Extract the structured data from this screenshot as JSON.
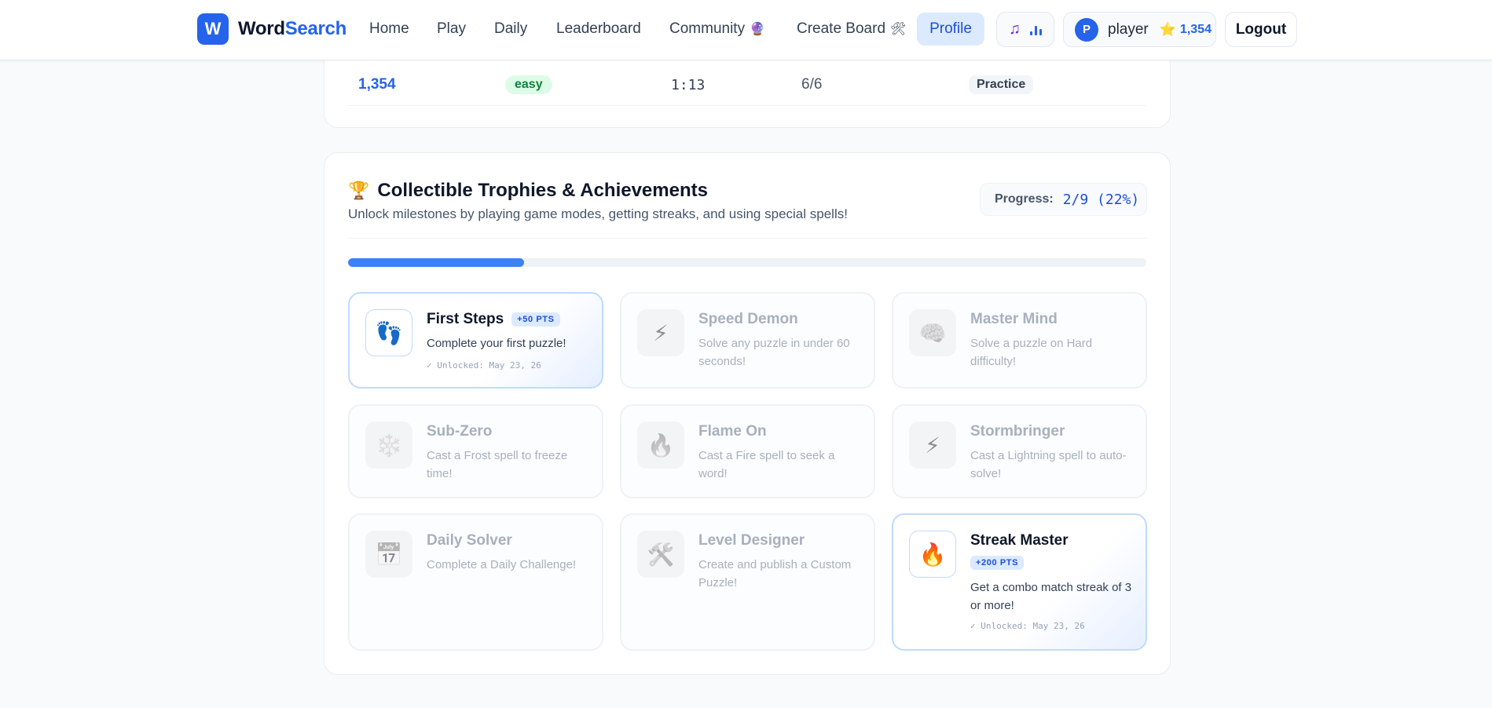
{
  "nav": {
    "logo_letter": "W",
    "brand_word1": "Word",
    "brand_word2": "Search",
    "links": [
      {
        "label": "Home",
        "emoji": ""
      },
      {
        "label": "Play",
        "emoji": ""
      },
      {
        "label": "Daily",
        "emoji": ""
      },
      {
        "label": "Leaderboard",
        "emoji": ""
      },
      {
        "label": "Community",
        "emoji": "🔮"
      },
      {
        "label": "Create Board",
        "emoji": "🛠"
      }
    ],
    "profile_label": "Profile",
    "music_icon": "music-note-icon",
    "user": {
      "avatar_letter": "P",
      "name": "player",
      "star": "⭐",
      "score": "1,354"
    },
    "logout_label": "Logout"
  },
  "history": {
    "score": "1,354",
    "difficulty": "easy",
    "time": "1:13",
    "found": "6/6",
    "mode": "Practice"
  },
  "trophies": {
    "title_icon": "🏆",
    "title": "Collectible Trophies & Achievements",
    "subtitle": "Unlock milestones by playing game modes, getting streaks, and using special spells!",
    "progress_label": "Progress:",
    "progress_value": "2/9 (22%)",
    "progress_fraction": 0.22,
    "items": [
      {
        "name": "First Steps",
        "icon": "👣",
        "pts": "+50 PTS",
        "desc": "Complete your first puzzle!",
        "unlocked": "✓ Unlocked: May 23, 26",
        "status": "unlocked"
      },
      {
        "name": "Speed Demon",
        "icon": "⚡",
        "pts": "",
        "desc": "Solve any puzzle in under 60 seconds!",
        "unlocked": "",
        "status": "locked"
      },
      {
        "name": "Master Mind",
        "icon": "🧠",
        "pts": "",
        "desc": "Solve a puzzle on Hard difficulty!",
        "unlocked": "",
        "status": "locked"
      },
      {
        "name": "Sub-Zero",
        "icon": "❄️",
        "pts": "",
        "desc": "Cast a Frost spell to freeze time!",
        "unlocked": "",
        "status": "locked"
      },
      {
        "name": "Flame On",
        "icon": "🔥",
        "pts": "",
        "desc": "Cast a Fire spell to seek a word!",
        "unlocked": "",
        "status": "locked"
      },
      {
        "name": "Stormbringer",
        "icon": "⚡",
        "pts": "",
        "desc": "Cast a Lightning spell to auto-solve!",
        "unlocked": "",
        "status": "locked"
      },
      {
        "name": "Daily Solver",
        "icon": "📅",
        "pts": "",
        "desc": "Complete a Daily Challenge!",
        "unlocked": "",
        "status": "locked"
      },
      {
        "name": "Level Designer",
        "icon": "🛠️",
        "pts": "",
        "desc": "Create and publish a Custom Puzzle!",
        "unlocked": "",
        "status": "locked"
      },
      {
        "name": "Streak Master",
        "icon": "🔥",
        "pts": "+200 PTS",
        "desc": "Get a combo match streak of 3 or more!",
        "unlocked": "✓ Unlocked: May 23, 26",
        "status": "unlocked"
      }
    ]
  }
}
